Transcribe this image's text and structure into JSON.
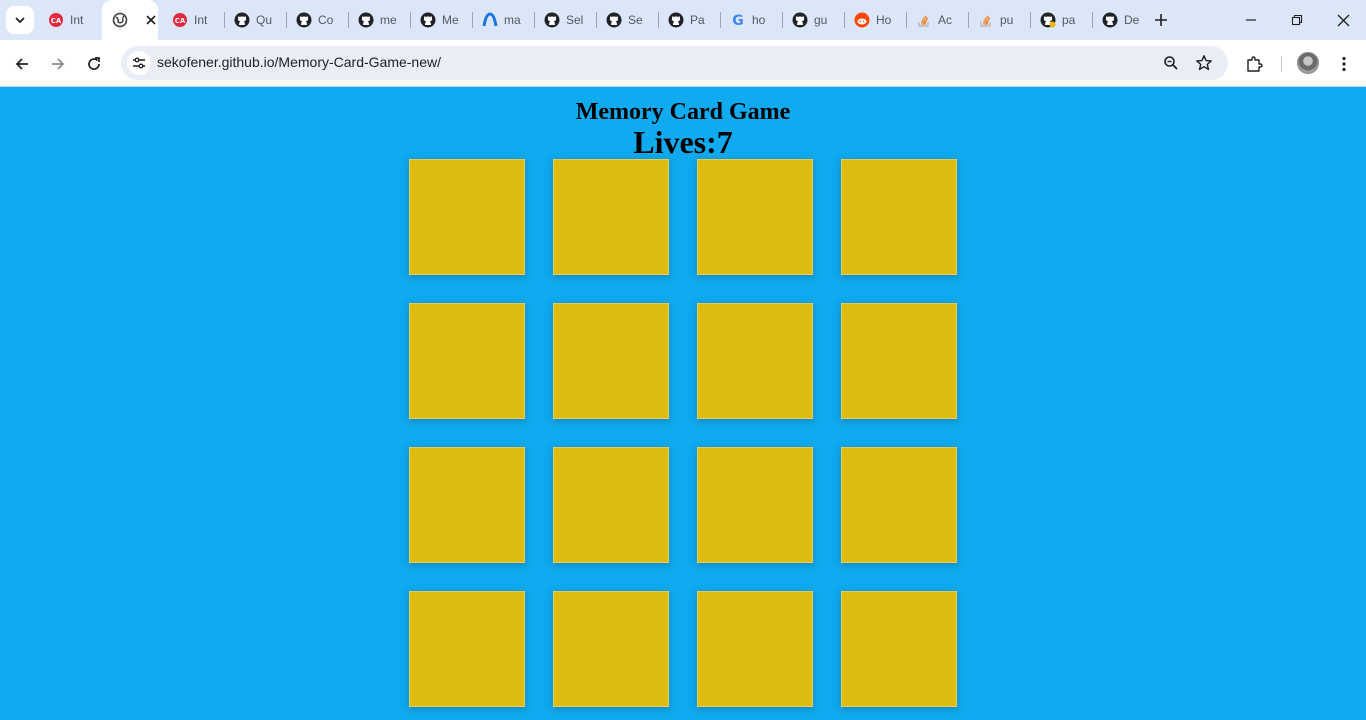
{
  "browser": {
    "tabs": [
      {
        "label": "Int",
        "icon": "cineflix-icon",
        "color": "#e5283e"
      },
      {
        "label": "",
        "icon": "globe-icon",
        "active": true
      },
      {
        "label": "Int",
        "icon": "cineflix-icon",
        "color": "#e5283e"
      },
      {
        "label": "Qu",
        "icon": "github-icon"
      },
      {
        "label": "Co",
        "icon": "github-icon"
      },
      {
        "label": "me",
        "icon": "github-icon"
      },
      {
        "label": "Me",
        "icon": "github-icon"
      },
      {
        "label": "ma",
        "icon": "arc-icon",
        "color": "#1a73e8"
      },
      {
        "label": "Sel",
        "icon": "github-icon"
      },
      {
        "label": "Se",
        "icon": "github-icon"
      },
      {
        "label": "Pa",
        "icon": "github-icon"
      },
      {
        "label": "ho",
        "icon": "google-icon"
      },
      {
        "label": "gu",
        "icon": "github-icon"
      },
      {
        "label": "Ho",
        "icon": "reddit-icon",
        "color": "#ff4500"
      },
      {
        "label": "Ac",
        "icon": "stackoverflow-icon",
        "color": "#f48024"
      },
      {
        "label": "pu",
        "icon": "stackoverflow-icon",
        "color": "#f48024"
      },
      {
        "label": "pa",
        "icon": "github-icon"
      },
      {
        "label": "De",
        "icon": "github-icon"
      }
    ],
    "url": "sekofener.github.io/Memory-Card-Game-new/"
  },
  "game": {
    "title": "Memory Card Game",
    "lives_label": "Lives:",
    "lives": "7",
    "card_color": "#dcbc0e",
    "background_color": "#0faaef",
    "card_count": 16
  }
}
